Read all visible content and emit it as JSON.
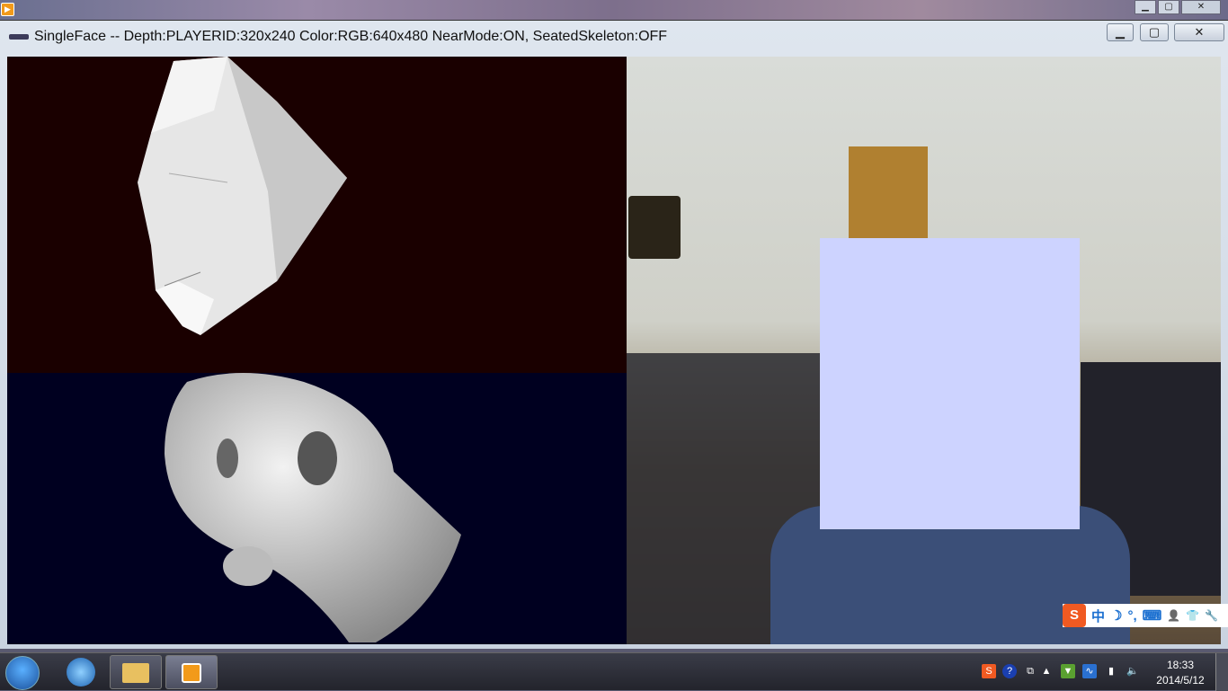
{
  "window": {
    "title": "SingleFace -- Depth:PLAYERID:320x240 Color:RGB:640x480 NearMode:ON, SeatedSkeleton:OFF",
    "minimize": "▁",
    "maximize": "▢",
    "close": "✕"
  },
  "ime": {
    "logo": "S",
    "mode": "中",
    "moon": "☽",
    "punct": "°,",
    "keyboard": "⌨",
    "user": "👤",
    "skin": "👕",
    "tools": "🔧"
  },
  "tray": {
    "sogou": "S",
    "help": "?",
    "time": "18:33",
    "date": "2014/5/12"
  },
  "colors": {
    "face_mask": "#cdd3ff",
    "panel_top": "#1a0000",
    "panel_bottom": "#000020"
  }
}
